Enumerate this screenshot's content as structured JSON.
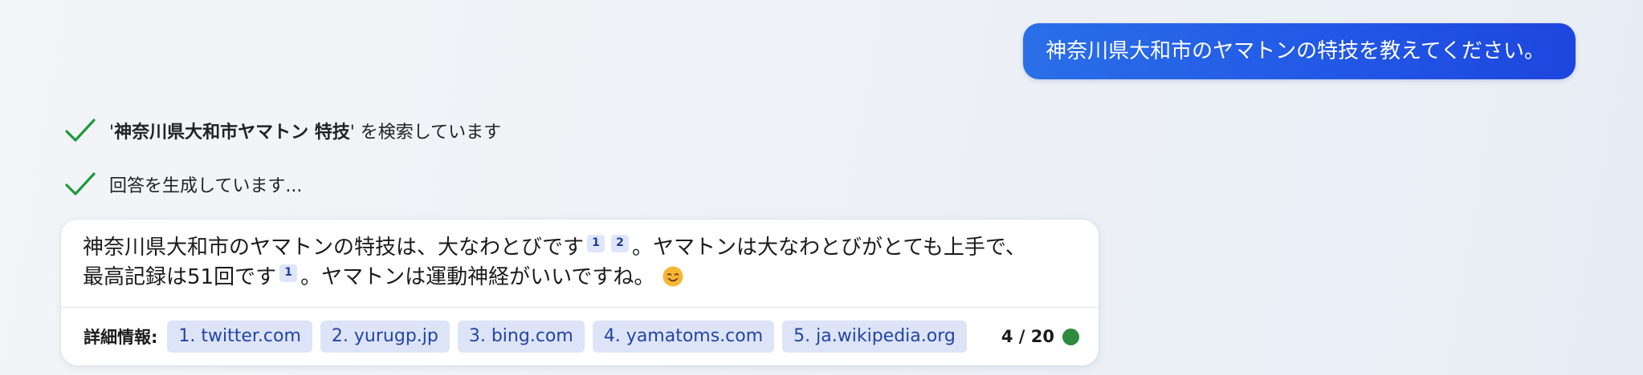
{
  "user_message": "神奈川県大和市のヤマトンの特技を教えてください。",
  "status": {
    "search_quote_open": "'",
    "search_query": "神奈川県大和市ヤマトン 特技",
    "search_quote_close": "'",
    "search_suffix": " を検索しています",
    "generating": "回答を生成しています..."
  },
  "answer": {
    "line1_text": "神奈川県大和市のヤマトンの特技は、大なわとびです",
    "line1_cite1": "1",
    "line1_cite2": "2",
    "line1_text2": "。ヤマトンは大なわとびがとても上手で、",
    "line2_text": "最高記録は51回です",
    "line2_cite1": "1",
    "line2_text2": "。ヤマトンは運動神経がいいですね。",
    "emoji_icon": "smiling-face-icon"
  },
  "footer": {
    "details_label": "詳細情報:",
    "sources": [
      "1. twitter.com",
      "2. yurugp.jp",
      "3. bing.com",
      "4. yamatoms.com",
      "5. ja.wikipedia.org"
    ],
    "counter": "4 / 20",
    "status_color": "#2e8b3e"
  },
  "colors": {
    "accent": "#2258e6",
    "check": "#1f9a3c",
    "chip_bg": "#dde4f8",
    "chip_text": "#2344a5"
  }
}
